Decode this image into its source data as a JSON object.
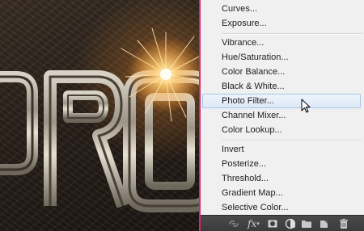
{
  "menu": {
    "items": [
      {
        "label": "Curves..."
      },
      {
        "label": "Exposure..."
      },
      {
        "label": "Vibrance..."
      },
      {
        "label": "Hue/Saturation..."
      },
      {
        "label": "Color Balance..."
      },
      {
        "label": "Black & White..."
      },
      {
        "label": "Photo Filter..."
      },
      {
        "label": "Channel Mixer..."
      },
      {
        "label": "Color Lookup..."
      },
      {
        "label": "Invert"
      },
      {
        "label": "Posterize..."
      },
      {
        "label": "Threshold..."
      },
      {
        "label": "Gradient Map..."
      },
      {
        "label": "Selective Color..."
      }
    ],
    "highlighted": "Photo Filter..."
  },
  "toolbar": {
    "fx_label": "fx",
    "icons": [
      "link-icon",
      "fx-icon",
      "add-mask-icon",
      "adjustment-layer-icon",
      "group-folder-icon",
      "new-layer-icon",
      "trash-icon"
    ]
  },
  "colors": {
    "canvas_border": "#d6287a",
    "menu_background": "#f0f0f0",
    "menu_highlight": "#dde9f7",
    "toolbar_background": "#3f3f3f"
  }
}
